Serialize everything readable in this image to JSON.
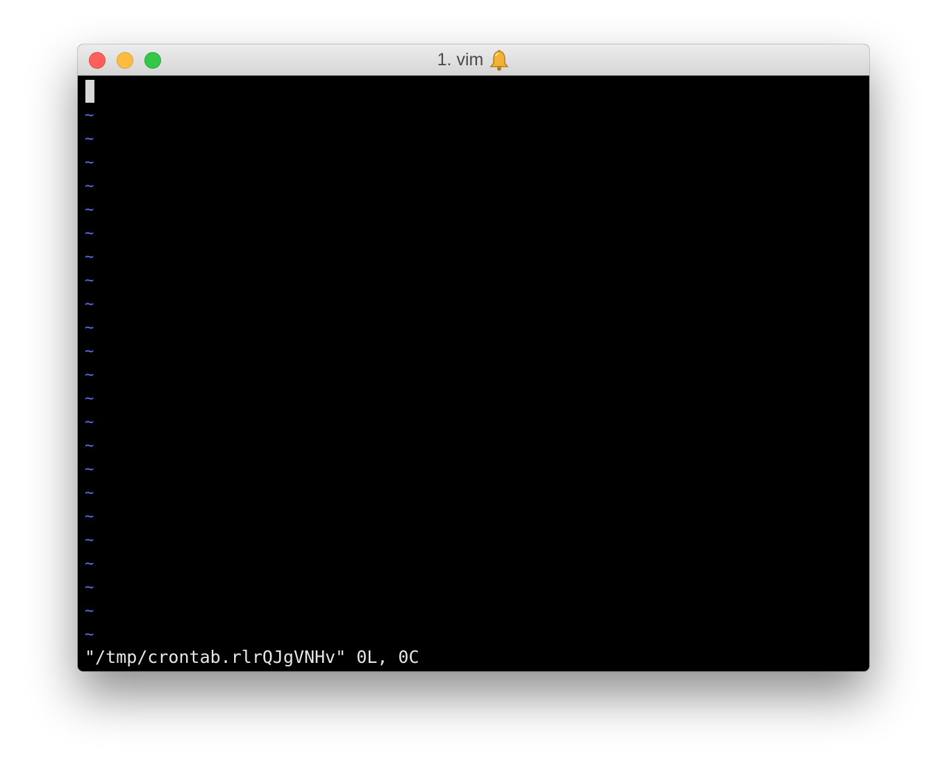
{
  "window": {
    "title": "1. vim",
    "title_icon": "bell-icon"
  },
  "editor": {
    "tilde_char": "~",
    "tilde_lines": 23,
    "status_message": "\"/tmp/crontab.rlrQJgVNHv\" 0L, 0C"
  },
  "colors": {
    "tilde": "#5f6fff",
    "background": "#000000",
    "text": "#e6e6e6",
    "cursor": "#d9d9d9"
  }
}
